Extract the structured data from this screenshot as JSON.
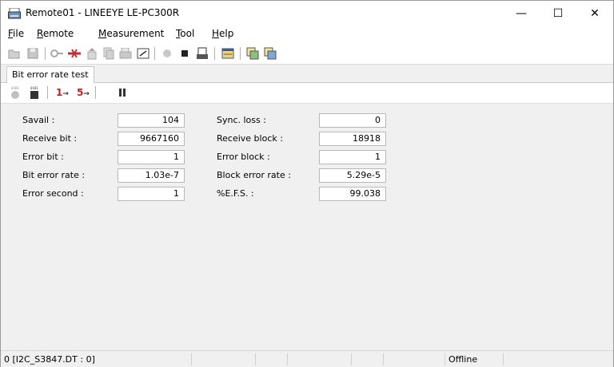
{
  "window": {
    "title": "Remote01 - LINEEYE LE-PC300R"
  },
  "controls": {
    "minimize": "—",
    "maximize": "☐",
    "close": "✕"
  },
  "menu": {
    "items": [
      {
        "accel": "F",
        "rest": "ile"
      },
      {
        "accel": "R",
        "rest": "emote"
      },
      {
        "accel": "M",
        "rest": "easurement"
      },
      {
        "accel": "T",
        "rest": "ool"
      },
      {
        "accel": "H",
        "rest": "elp"
      }
    ]
  },
  "tabs": [
    {
      "label": "Bit error rate test"
    }
  ],
  "subtoolbar": {
    "t1_label": "1",
    "t5_label": "5",
    "arrow": "→",
    "bits_label": "0101"
  },
  "stats": {
    "left": [
      {
        "label": "Savail :",
        "value": "104"
      },
      {
        "label": "Receive bit :",
        "value": "9667160"
      },
      {
        "label": "Error bit :",
        "value": "1"
      },
      {
        "label": "Bit error rate :",
        "value": "1.03e-7"
      },
      {
        "label": "Error second :",
        "value": "1"
      }
    ],
    "right": [
      {
        "label": "Sync. loss :",
        "value": "0"
      },
      {
        "label": "Receive block :",
        "value": "18918"
      },
      {
        "label": "Error block :",
        "value": "1"
      },
      {
        "label": "Block error rate :",
        "value": "5.29e-5"
      },
      {
        "label": "%E.F.S. :",
        "value": "99.038"
      }
    ]
  },
  "status": {
    "port": "0 [I2C_S3847.DT : 0]",
    "state": "Offline"
  }
}
